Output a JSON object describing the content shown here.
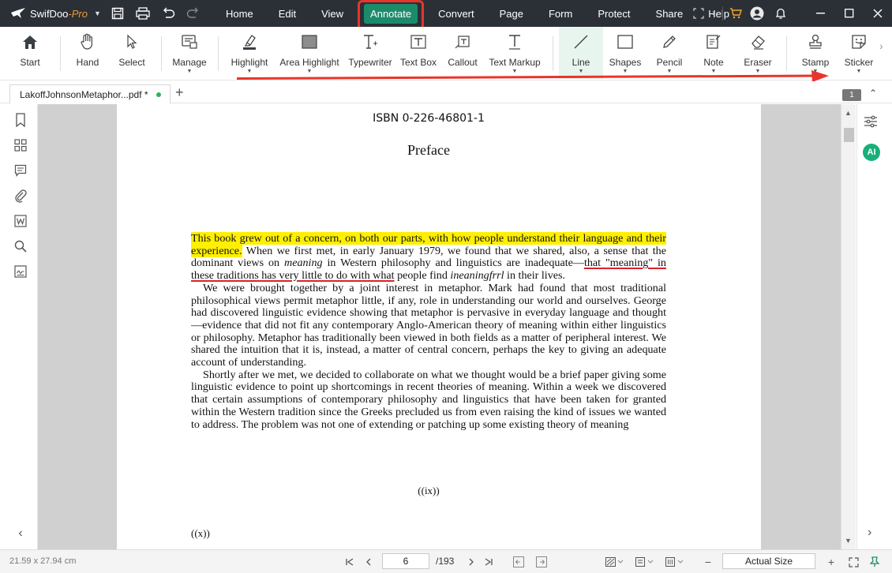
{
  "app": {
    "name": "SwifDoo",
    "edition": "-Pro"
  },
  "menu": [
    {
      "label": "Home"
    },
    {
      "label": "Edit"
    },
    {
      "label": "View"
    },
    {
      "label": "Annotate",
      "active": true
    },
    {
      "label": "Convert"
    },
    {
      "label": "Page"
    },
    {
      "label": "Form"
    },
    {
      "label": "Protect"
    },
    {
      "label": "Share"
    },
    {
      "label": "Help"
    }
  ],
  "ribbon": {
    "start": "Start",
    "hand": "Hand",
    "select": "Select",
    "manage": "Manage",
    "highlight": "Highlight",
    "area_highlight": "Area Highlight",
    "typewriter": "Typewriter",
    "text_box": "Text Box",
    "callout": "Callout",
    "text_markup": "Text Markup",
    "line": "Line",
    "shapes": "Shapes",
    "pencil": "Pencil",
    "note": "Note",
    "eraser": "Eraser",
    "stamp": "Stamp",
    "sticker": "Sticker"
  },
  "tab": {
    "title": "LakoffJohnsonMetaphor...pdf *"
  },
  "page_badge": "1",
  "document": {
    "isbn": "ISBN 0-226-46801-1",
    "heading": "Preface",
    "p1_highlight": "This book grew out of a concern, on both our parts, with how people understand their language and their experience.",
    "p1_a": " When we first met, in early January 1979, we found that we shared, also, a sense that the dominant views on ",
    "p1_meaning": "meaning",
    "p1_b": " in Western philosophy and linguistics are inadequate—",
    "p1_underline": "that \"meaning\" in these traditions has very little to do with what",
    "p1_c": " people find ",
    "p1_meaningful": "ineaningfrrl",
    "p1_d": " in their lives.",
    "p2": "We were brought together by a joint interest in metaphor. Mark had found that most traditional philosophical views permit metaphor little, if any, role in understanding our world and ourselves. George had discovered linguistic evidence showing that metaphor is pervasive in everyday language and thought—evidence that did not fit any contemporary Anglo-American theory of meaning within either linguistics or philosophy. Metaphor has traditionally been viewed in both fields as a matter of peripheral interest. We shared the intuition that it is, instead, a matter of central concern, perhaps the key to giving an adequate account of understanding.",
    "p3": "Shortly after we met, we decided to collaborate on what we thought would be a brief paper giving some linguistic evidence to point up shortcomings in recent theories of meaning. Within a week we discovered that certain assumptions of contemporary philosophy and linguistics that have been taken for granted within the Western tradition since the Greeks precluded us from even raising the kind of issues we wanted to address. The problem was not one of extending or patching up some existing theory of meaning",
    "page_number_1": "((ix))",
    "page_number_2": "((x))"
  },
  "sidebar_right": {
    "ai_label": "AI"
  },
  "status": {
    "dimensions": "21.59 x 27.94 cm",
    "current_page": "6",
    "total_pages": "/193",
    "zoom": "Actual Size"
  },
  "colors": {
    "titlebar": "#2b3037",
    "accent": "#1c8b6c",
    "highlight": "#ffef00",
    "annotation_red": "#e8352b",
    "pro": "#f39a2b"
  }
}
